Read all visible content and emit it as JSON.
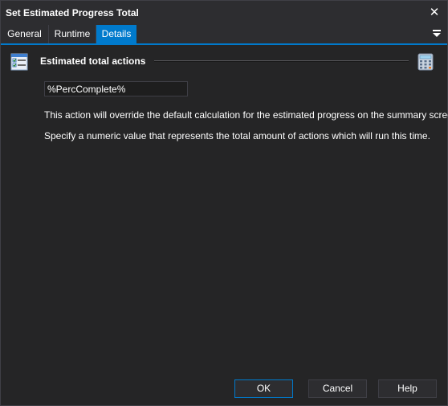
{
  "window": {
    "title": "Set Estimated Progress Total"
  },
  "tabs": [
    {
      "label": "General",
      "active": false
    },
    {
      "label": "Runtime",
      "active": false
    },
    {
      "label": "Details",
      "active": true
    }
  ],
  "section": {
    "title": "Estimated total actions"
  },
  "input": {
    "value": "%PercComplete%"
  },
  "description": {
    "line1": "This action will override the default calculation for the estimated progress on the summary screen.",
    "line2": "Specify a numeric value that represents the total amount of actions which will run this time."
  },
  "buttons": {
    "ok": "OK",
    "cancel": "Cancel",
    "help": "Help"
  },
  "icons": {
    "close": "close-icon",
    "tab_menu": "menu-dropdown-icon",
    "section": "properties-list-icon",
    "calculator": "calculator-icon"
  },
  "colors": {
    "accent": "#007acc",
    "background": "#252526",
    "titlebar": "#2d2d30"
  }
}
